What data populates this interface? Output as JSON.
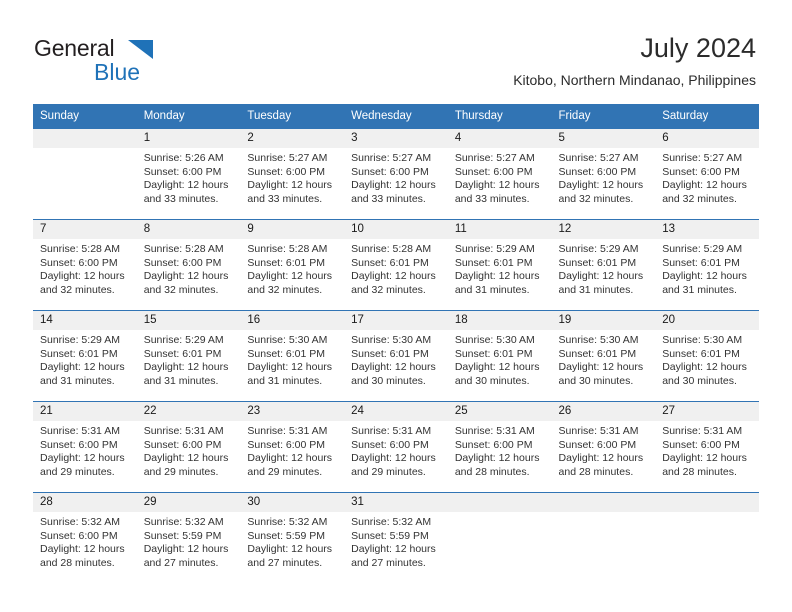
{
  "brand": {
    "line1": "General",
    "line2": "Blue",
    "triangle_color": "#1f72b8",
    "text_color": "#231f20"
  },
  "header": {
    "title": "July 2024",
    "subtitle": "Kitobo, Northern Mindanao, Philippines"
  },
  "theme": {
    "header_row_bg": "#3174b4",
    "header_row_text": "#ffffff",
    "daynum_bg": "#f0f0f0",
    "cell_bg": "#ffffff",
    "row_divider": "#3174b4"
  },
  "weekday_headers": [
    "Sunday",
    "Monday",
    "Tuesday",
    "Wednesday",
    "Thursday",
    "Friday",
    "Saturday"
  ],
  "weeks": [
    [
      {
        "day": "",
        "lines": []
      },
      {
        "day": "1",
        "lines": [
          "Sunrise: 5:26 AM",
          "Sunset: 6:00 PM",
          "Daylight: 12 hours",
          "and 33 minutes."
        ]
      },
      {
        "day": "2",
        "lines": [
          "Sunrise: 5:27 AM",
          "Sunset: 6:00 PM",
          "Daylight: 12 hours",
          "and 33 minutes."
        ]
      },
      {
        "day": "3",
        "lines": [
          "Sunrise: 5:27 AM",
          "Sunset: 6:00 PM",
          "Daylight: 12 hours",
          "and 33 minutes."
        ]
      },
      {
        "day": "4",
        "lines": [
          "Sunrise: 5:27 AM",
          "Sunset: 6:00 PM",
          "Daylight: 12 hours",
          "and 33 minutes."
        ]
      },
      {
        "day": "5",
        "lines": [
          "Sunrise: 5:27 AM",
          "Sunset: 6:00 PM",
          "Daylight: 12 hours",
          "and 32 minutes."
        ]
      },
      {
        "day": "6",
        "lines": [
          "Sunrise: 5:27 AM",
          "Sunset: 6:00 PM",
          "Daylight: 12 hours",
          "and 32 minutes."
        ]
      }
    ],
    [
      {
        "day": "7",
        "lines": [
          "Sunrise: 5:28 AM",
          "Sunset: 6:00 PM",
          "Daylight: 12 hours",
          "and 32 minutes."
        ]
      },
      {
        "day": "8",
        "lines": [
          "Sunrise: 5:28 AM",
          "Sunset: 6:00 PM",
          "Daylight: 12 hours",
          "and 32 minutes."
        ]
      },
      {
        "day": "9",
        "lines": [
          "Sunrise: 5:28 AM",
          "Sunset: 6:01 PM",
          "Daylight: 12 hours",
          "and 32 minutes."
        ]
      },
      {
        "day": "10",
        "lines": [
          "Sunrise: 5:28 AM",
          "Sunset: 6:01 PM",
          "Daylight: 12 hours",
          "and 32 minutes."
        ]
      },
      {
        "day": "11",
        "lines": [
          "Sunrise: 5:29 AM",
          "Sunset: 6:01 PM",
          "Daylight: 12 hours",
          "and 31 minutes."
        ]
      },
      {
        "day": "12",
        "lines": [
          "Sunrise: 5:29 AM",
          "Sunset: 6:01 PM",
          "Daylight: 12 hours",
          "and 31 minutes."
        ]
      },
      {
        "day": "13",
        "lines": [
          "Sunrise: 5:29 AM",
          "Sunset: 6:01 PM",
          "Daylight: 12 hours",
          "and 31 minutes."
        ]
      }
    ],
    [
      {
        "day": "14",
        "lines": [
          "Sunrise: 5:29 AM",
          "Sunset: 6:01 PM",
          "Daylight: 12 hours",
          "and 31 minutes."
        ]
      },
      {
        "day": "15",
        "lines": [
          "Sunrise: 5:29 AM",
          "Sunset: 6:01 PM",
          "Daylight: 12 hours",
          "and 31 minutes."
        ]
      },
      {
        "day": "16",
        "lines": [
          "Sunrise: 5:30 AM",
          "Sunset: 6:01 PM",
          "Daylight: 12 hours",
          "and 31 minutes."
        ]
      },
      {
        "day": "17",
        "lines": [
          "Sunrise: 5:30 AM",
          "Sunset: 6:01 PM",
          "Daylight: 12 hours",
          "and 30 minutes."
        ]
      },
      {
        "day": "18",
        "lines": [
          "Sunrise: 5:30 AM",
          "Sunset: 6:01 PM",
          "Daylight: 12 hours",
          "and 30 minutes."
        ]
      },
      {
        "day": "19",
        "lines": [
          "Sunrise: 5:30 AM",
          "Sunset: 6:01 PM",
          "Daylight: 12 hours",
          "and 30 minutes."
        ]
      },
      {
        "day": "20",
        "lines": [
          "Sunrise: 5:30 AM",
          "Sunset: 6:01 PM",
          "Daylight: 12 hours",
          "and 30 minutes."
        ]
      }
    ],
    [
      {
        "day": "21",
        "lines": [
          "Sunrise: 5:31 AM",
          "Sunset: 6:00 PM",
          "Daylight: 12 hours",
          "and 29 minutes."
        ]
      },
      {
        "day": "22",
        "lines": [
          "Sunrise: 5:31 AM",
          "Sunset: 6:00 PM",
          "Daylight: 12 hours",
          "and 29 minutes."
        ]
      },
      {
        "day": "23",
        "lines": [
          "Sunrise: 5:31 AM",
          "Sunset: 6:00 PM",
          "Daylight: 12 hours",
          "and 29 minutes."
        ]
      },
      {
        "day": "24",
        "lines": [
          "Sunrise: 5:31 AM",
          "Sunset: 6:00 PM",
          "Daylight: 12 hours",
          "and 29 minutes."
        ]
      },
      {
        "day": "25",
        "lines": [
          "Sunrise: 5:31 AM",
          "Sunset: 6:00 PM",
          "Daylight: 12 hours",
          "and 28 minutes."
        ]
      },
      {
        "day": "26",
        "lines": [
          "Sunrise: 5:31 AM",
          "Sunset: 6:00 PM",
          "Daylight: 12 hours",
          "and 28 minutes."
        ]
      },
      {
        "day": "27",
        "lines": [
          "Sunrise: 5:31 AM",
          "Sunset: 6:00 PM",
          "Daylight: 12 hours",
          "and 28 minutes."
        ]
      }
    ],
    [
      {
        "day": "28",
        "lines": [
          "Sunrise: 5:32 AM",
          "Sunset: 6:00 PM",
          "Daylight: 12 hours",
          "and 28 minutes."
        ]
      },
      {
        "day": "29",
        "lines": [
          "Sunrise: 5:32 AM",
          "Sunset: 5:59 PM",
          "Daylight: 12 hours",
          "and 27 minutes."
        ]
      },
      {
        "day": "30",
        "lines": [
          "Sunrise: 5:32 AM",
          "Sunset: 5:59 PM",
          "Daylight: 12 hours",
          "and 27 minutes."
        ]
      },
      {
        "day": "31",
        "lines": [
          "Sunrise: 5:32 AM",
          "Sunset: 5:59 PM",
          "Daylight: 12 hours",
          "and 27 minutes."
        ]
      },
      {
        "day": "",
        "lines": []
      },
      {
        "day": "",
        "lines": []
      },
      {
        "day": "",
        "lines": []
      }
    ]
  ]
}
